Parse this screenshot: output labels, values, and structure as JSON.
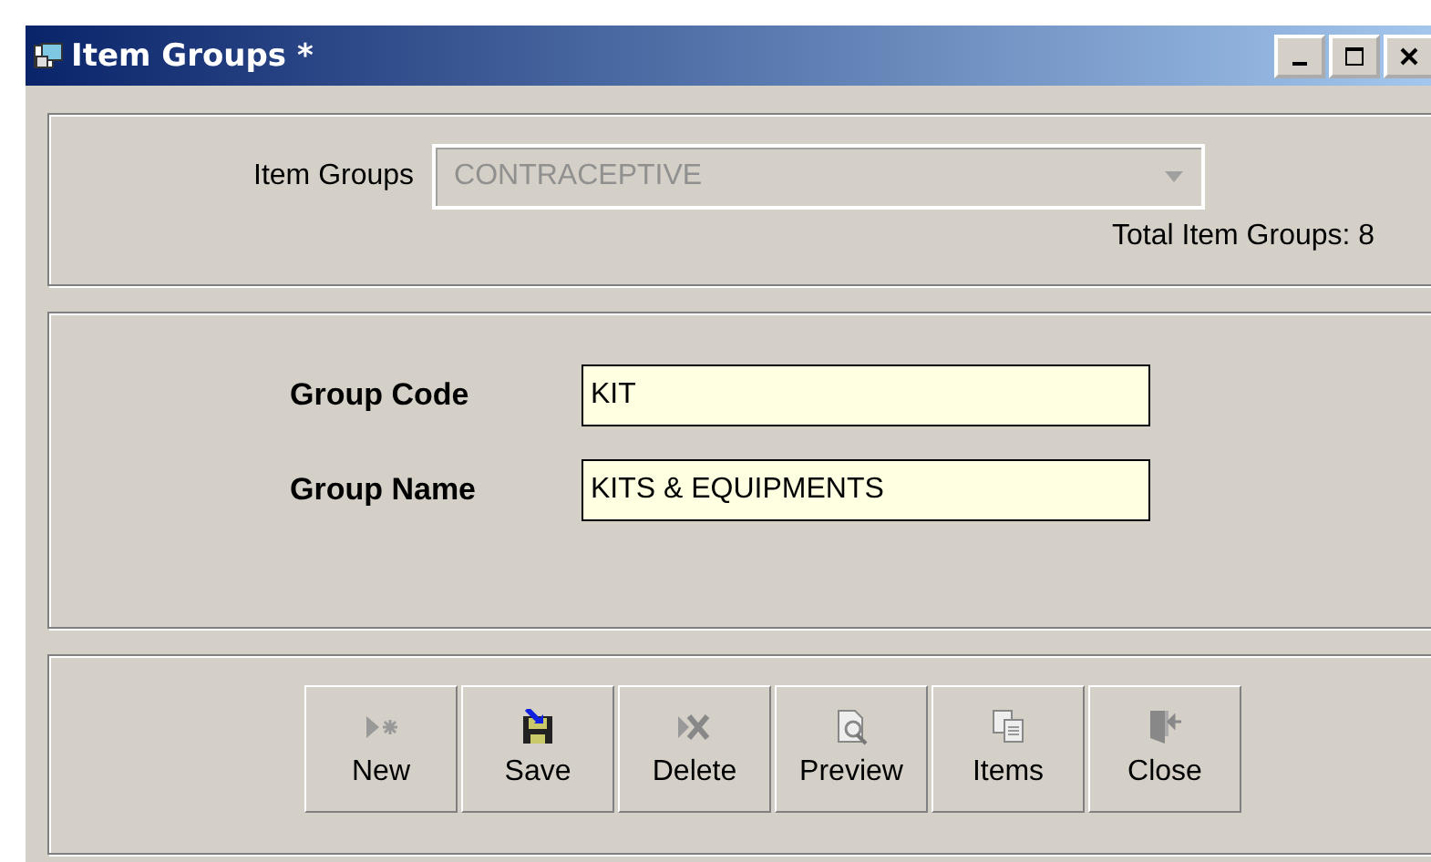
{
  "window": {
    "title": "Item Groups *"
  },
  "selector": {
    "label": "Item Groups",
    "value": "CONTRACEPTIVE",
    "disabled": true,
    "total": "Total Item Groups: 8"
  },
  "fields": [
    {
      "label": "Group Code",
      "value": "KIT"
    },
    {
      "label": "Group Name",
      "value": "KITS & EQUIPMENTS"
    }
  ],
  "buttons": [
    {
      "label": "New",
      "kind": "new"
    },
    {
      "label": "Save",
      "kind": "save"
    },
    {
      "label": "Delete",
      "kind": "delete"
    },
    {
      "label": "Preview",
      "kind": "preview"
    },
    {
      "label": "Items",
      "kind": "items"
    },
    {
      "label": "Close",
      "kind": "close"
    }
  ]
}
